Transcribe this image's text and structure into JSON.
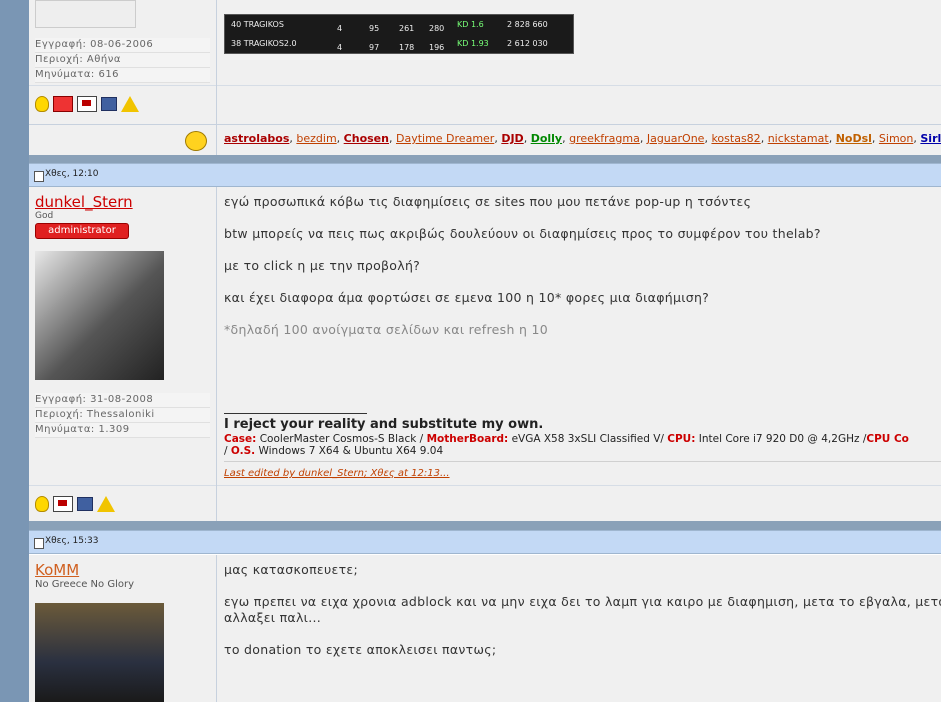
{
  "post0": {
    "meta": [
      "Εγγραφή: 08-06-2006",
      "Περιοχή: Αθήνα",
      "Μηνύματα: 616"
    ],
    "banner": {
      "row1": [
        "40 TRAGIKOS",
        "4",
        "95",
        "261",
        "280",
        "KD 1.6",
        "2 828 660"
      ],
      "row2": [
        "38 TRAGIKOS2.0",
        "4",
        "97",
        "178",
        "196",
        "KD 1.93",
        "2 612 030"
      ]
    }
  },
  "thanks": {
    "users": [
      "astrolabos",
      "bezdim",
      "Chosen",
      "Daytime Dreamer",
      "DJD",
      "Dolly",
      "greekfragma",
      "JaguarOne",
      "kostas82",
      "nickstamat",
      "NoDsl",
      "Simon",
      "Sirl"
    ]
  },
  "post1": {
    "date": "Χθες, 12:10",
    "username": "dunkel_Stern",
    "title": "God",
    "rank": "administrator",
    "meta": [
      "Εγγραφή: 31-08-2008",
      "Περιοχή: Thessaloniki",
      "Μηνύματα: 1.309"
    ],
    "lines": [
      "εγώ προσωπικά κόβω τις διαφημίσεις σε sites που μου πετάνε pop-up η τσόντες",
      "btw μπορείς να πεις πως ακριβώς δουλεύουν οι διαφημίσεις προς το συμφέρον του thelab?",
      "με το click η με την προβολή?",
      "και έχει διαφορα άμα φορτώσει σε εμενα 100 η 10* φορες μια διαφήμιση?",
      "*δηλαδή 100 ανοίγματα σελίδων και refresh η 10"
    ],
    "sig_quote": "I reject your reality and substitute my own.",
    "sig": {
      "case_label": "Case:",
      "case_val": "CoolerMaster Cosmos-S Black /",
      "mb_label": "MotherBoard:",
      "mb_val": "eVGA X58 3xSLI Classified V/",
      "cpu_label": "CPU:",
      "cpu_val": "Intel Core i7 920 D0 @ 4,2GHz /",
      "cpuc_label": "CPU Co",
      "os_prefix": "/",
      "os_label": "O.S.",
      "os_val": "Windows 7 X64 & Ubuntu X64 9.04"
    },
    "edited_link": "Last edited by dunkel_Stern",
    "edited_rest": "; Χθες at 12:13..."
  },
  "post2": {
    "date": "Χθες, 15:33",
    "username": "KoMM",
    "title": "No Greece No Glory",
    "lines": [
      "μας κατασκοπευετε;",
      "εγω πρεπει να ειχα χρονια adblock και να μην ειχα δει το λαμπ για καιρο με διαφημιση, μετα το εβγαλα, μετα",
      "αλλαξει παλι...",
      "το donation το εχετε αποκλεισει παντως;"
    ]
  }
}
